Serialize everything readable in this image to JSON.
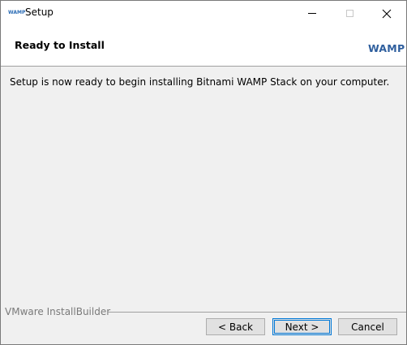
{
  "titlebar": {
    "logo_text": "WAMP",
    "title": "Setup",
    "minimize_icon": "minimize-icon",
    "maximize_icon": "maximize-icon",
    "close_icon": "close-icon",
    "close_glyph": "✕"
  },
  "header": {
    "title": "Ready to Install",
    "logo_text": "WAMP",
    "logo_color": "#2f5f9e"
  },
  "content": {
    "message": "Setup is now ready to begin installing Bitnami WAMP Stack on your computer."
  },
  "footer": {
    "builder_label": "VMware InstallBuilder",
    "back_label": "< Back",
    "next_label": "Next >",
    "cancel_label": "Cancel"
  }
}
